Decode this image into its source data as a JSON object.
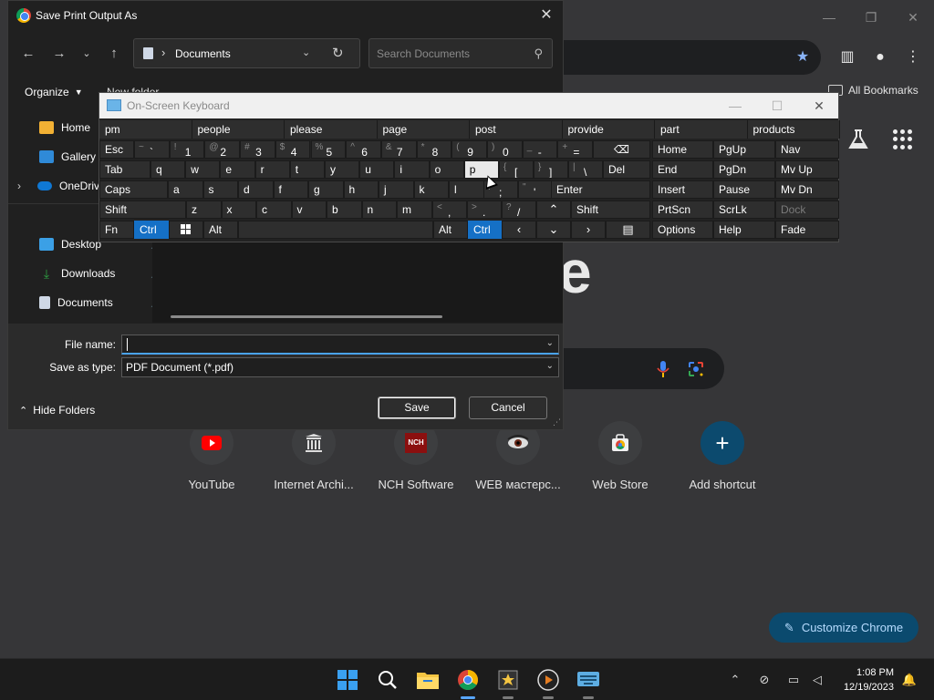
{
  "chrome": {
    "bookmarks_label": "All Bookmarks",
    "logo_fragment": "e",
    "shortcuts": [
      {
        "label": "YouTube",
        "icon": "youtube-icon"
      },
      {
        "label": "Internet Archi...",
        "icon": "internet-archive-icon"
      },
      {
        "label": "NCH Software",
        "icon": "nch-software-icon"
      },
      {
        "label": "WEB мастерс...",
        "icon": "web-master-icon"
      },
      {
        "label": "Web Store",
        "icon": "web-store-icon"
      },
      {
        "label": "Add shortcut",
        "icon": "plus-icon"
      }
    ],
    "customize_label": "Customize Chrome",
    "accent": "#8ab4f8"
  },
  "save_dialog": {
    "title": "Save Print Output As",
    "address": "Documents",
    "search_placeholder": "Search Documents",
    "organize_label": "Organize",
    "new_folder_label": "New folder",
    "nav_items": [
      {
        "label": "Home"
      },
      {
        "label": "Gallery"
      },
      {
        "label": "OneDrive"
      },
      {
        "label": "Desktop"
      },
      {
        "label": "Downloads"
      },
      {
        "label": "Documents"
      }
    ],
    "file_name_label": "File name:",
    "file_name_value": "",
    "save_type_label": "Save as type:",
    "save_type_value": "PDF Document (*.pdf)",
    "hide_folders_label": "Hide Folders",
    "save_label": "Save",
    "cancel_label": "Cancel"
  },
  "osk": {
    "title": "On-Screen Keyboard",
    "suggestions": [
      "pm",
      "people",
      "please",
      "page",
      "post",
      "provide",
      "part",
      "products"
    ],
    "rows": {
      "r1": {
        "esc": "Esc",
        "keys": [
          {
            "shift": "~",
            "base": "`"
          },
          {
            "shift": "!",
            "base": "1"
          },
          {
            "shift": "@",
            "base": "2"
          },
          {
            "shift": "#",
            "base": "3"
          },
          {
            "shift": "$",
            "base": "4"
          },
          {
            "shift": "%",
            "base": "5"
          },
          {
            "shift": "^",
            "base": "6"
          },
          {
            "shift": "&",
            "base": "7"
          },
          {
            "shift": "*",
            "base": "8"
          },
          {
            "shift": "(",
            "base": "9"
          },
          {
            "shift": ")",
            "base": "0"
          },
          {
            "shift": "_",
            "base": "-"
          },
          {
            "shift": "+",
            "base": "="
          }
        ],
        "backspace": "⌫"
      },
      "r2": {
        "tab": "Tab",
        "letters": [
          "q",
          "w",
          "e",
          "r",
          "t",
          "y",
          "u",
          "i",
          "o",
          "p"
        ],
        "brackets": [
          {
            "shift": "{",
            "base": "["
          },
          {
            "shift": "}",
            "base": "]"
          },
          {
            "shift": "|",
            "base": "\\"
          }
        ],
        "del": "Del"
      },
      "r3": {
        "caps": "Caps",
        "letters": [
          "a",
          "s",
          "d",
          "f",
          "g",
          "h",
          "j",
          "k",
          "l"
        ],
        "punct": [
          {
            "shift": ":",
            "base": ";"
          },
          {
            "shift": "\"",
            "base": "'"
          }
        ],
        "enter": "Enter"
      },
      "r4": {
        "shift_l": "Shift",
        "letters": [
          "z",
          "x",
          "c",
          "v",
          "b",
          "n",
          "m"
        ],
        "punct": [
          {
            "shift": "<",
            "base": ","
          },
          {
            "shift": ">",
            "base": "."
          },
          {
            "shift": "?",
            "base": "/"
          }
        ],
        "shift_r": "Shift"
      },
      "r5": {
        "fn": "Fn",
        "ctrl_l": "Ctrl",
        "alt_l": "Alt",
        "alt_r": "Alt",
        "ctrl_r": "Ctrl"
      }
    },
    "nav_block": [
      [
        "Home",
        "PgUp",
        "Nav"
      ],
      [
        "End",
        "PgDn",
        "Mv Up"
      ],
      [
        "Insert",
        "Pause",
        "Mv Dn"
      ],
      [
        "PrtScn",
        "ScrLk",
        "Dock"
      ],
      [
        "Options",
        "Help",
        "Fade"
      ]
    ],
    "pressed_key": "p",
    "active_color": "#1570c6"
  },
  "taskbar": {
    "apps": [
      "start-icon",
      "search-icon",
      "file-explorer-icon",
      "chrome-icon",
      "movie-maker-icon",
      "media-player-icon",
      "on-screen-keyboard-icon"
    ],
    "time": "1:08 PM",
    "date": "12/19/2023"
  }
}
